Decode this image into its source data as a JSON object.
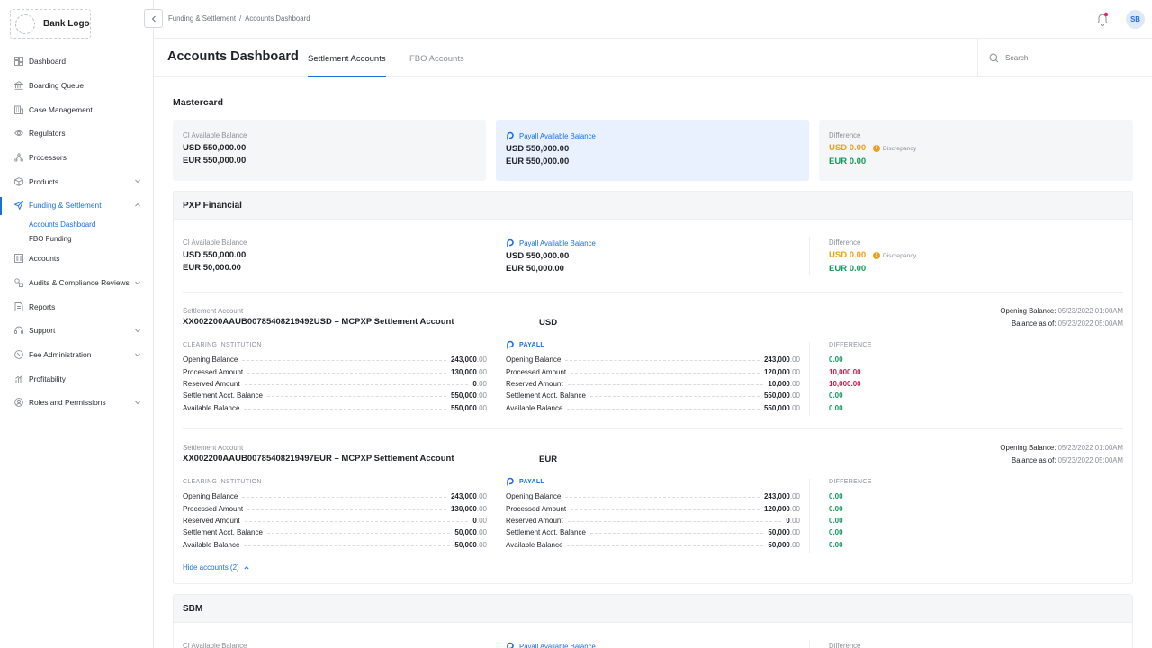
{
  "app": {
    "logo_text": "Bank Logo",
    "user_initials": "SB"
  },
  "breadcrumb": {
    "parent": "Funding & Settlement",
    "separator": "/",
    "current": "Accounts Dashboard"
  },
  "sidebar": {
    "items": [
      {
        "label": "Dashboard",
        "icon": "dashboard-icon"
      },
      {
        "label": "Boarding Queue",
        "icon": "bank-icon"
      },
      {
        "label": "Case Management",
        "icon": "building-icon"
      },
      {
        "label": "Regulators",
        "icon": "eye-icon"
      },
      {
        "label": "Processors",
        "icon": "processors-icon"
      },
      {
        "label": "Products",
        "icon": "box-icon"
      },
      {
        "label": "Funding & Settlement",
        "icon": "send-icon"
      },
      {
        "label": "Accounts",
        "icon": "accounts-icon"
      },
      {
        "label": "Audits & Compliance Reviews",
        "icon": "audit-icon"
      },
      {
        "label": "Reports",
        "icon": "report-icon"
      },
      {
        "label": "Support",
        "icon": "headset-icon"
      },
      {
        "label": "Fee Administration",
        "icon": "fee-icon"
      },
      {
        "label": "Profitability",
        "icon": "chart-icon"
      },
      {
        "label": "Roles and Permissions",
        "icon": "user-icon"
      }
    ],
    "sub_items": [
      "Accounts Dashboard",
      "FBO Funding"
    ]
  },
  "header": {
    "title": "Accounts Dashboard",
    "tabs": [
      "Settlement Accounts",
      "FBO Accounts"
    ],
    "search_placeholder": "Search"
  },
  "labels": {
    "ci_balance": "CI Available Balance",
    "payall_balance": "Payall Available Balance",
    "difference": "Difference",
    "discrepancy": "Discrepancy",
    "settlement_account": "Settlement Account",
    "opening_balance": "Opening Balance:",
    "balance_as_of": "Balance as of:",
    "clearing_institution": "CLEARING INSTITUTION",
    "payall": "PAYALL",
    "difference_caps": "DIFFERENCE"
  },
  "mastercard": {
    "title": "Mastercard",
    "ci": [
      "USD 550,000.00",
      "EUR 550,000.00"
    ],
    "payall": [
      "USD 550,000.00",
      "EUR 550,000.00"
    ],
    "diff": [
      "USD 0.00",
      "EUR 0.00"
    ]
  },
  "pxp": {
    "title": "PXP Financial",
    "ci": [
      "USD 550,000.00",
      "EUR 50,000.00"
    ],
    "payall": [
      "USD 550,000.00",
      "EUR 50,000.00"
    ],
    "diff": [
      "USD 0.00",
      "EUR 0.00"
    ],
    "hide_link": "Hide accounts (2)",
    "accounts": [
      {
        "name": "XX002200AAUB00785408219492USD – MCPXP Settlement Account",
        "currency": "USD",
        "opening_date": "05/23/2022 01:00AM",
        "asof_date": "05/23/2022 05:00AM",
        "rows": [
          "Opening Balance",
          "Processed Amount",
          "Reserved Amount",
          "Settlement Acct. Balance",
          "Available Balance"
        ],
        "ci_int": [
          "243,000",
          "130,000",
          "0",
          "550,000",
          "550,000"
        ],
        "payall_int": [
          "243,000",
          "120,000",
          "10,000",
          "550,000",
          "550,000"
        ],
        "decimals": ".00",
        "diff": [
          "0.00",
          "10,000.00",
          "10,000.00",
          "0.00",
          "0.00"
        ],
        "diff_colors": [
          "#129a5c",
          "#c21d4a",
          "#c21d4a",
          "#129a5c",
          "#129a5c"
        ]
      },
      {
        "name": "XX002200AAUB00785408219497EUR – MCPXP Settlement Account",
        "currency": "EUR",
        "opening_date": "05/23/2022 01:00AM",
        "asof_date": "05/23/2022 05:00AM",
        "rows": [
          "Opening Balance",
          "Processed Amount",
          "Reserved Amount",
          "Settlement Acct. Balance",
          "Available Balance"
        ],
        "ci_int": [
          "243,000",
          "130,000",
          "0",
          "50,000",
          "50,000"
        ],
        "payall_int": [
          "243,000",
          "120,000",
          "0",
          "50,000",
          "50,000"
        ],
        "decimals": ".00",
        "diff": [
          "0.00",
          "0.00",
          "0.00",
          "0.00",
          "0.00"
        ],
        "diff_colors": [
          "#129a5c",
          "#129a5c",
          "#129a5c",
          "#129a5c",
          "#129a5c"
        ]
      }
    ]
  },
  "sbm": {
    "title": "SBM"
  },
  "colors": {
    "accent": "#1a6fe0",
    "warning": "#e8a21c",
    "positive": "#129a5c",
    "negative": "#c21d4a"
  }
}
